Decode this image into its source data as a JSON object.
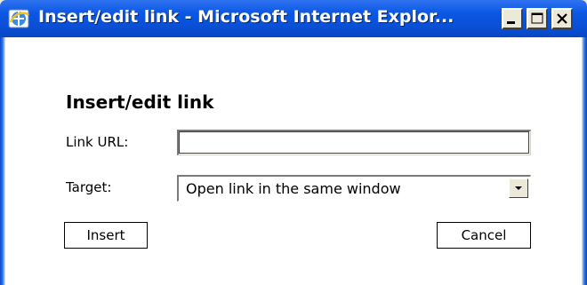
{
  "window": {
    "title": "Insert/edit link - Microsoft Internet Explor...",
    "icon": "ie-icon",
    "controls": [
      "minimize-icon",
      "maximize-icon",
      "close-icon"
    ]
  },
  "dialog": {
    "heading": "Insert/edit link",
    "url_label": "Link URL:",
    "url_value": "",
    "target_label": "Target:",
    "target_selected": "Open link in the same window",
    "insert_label": "Insert",
    "cancel_label": "Cancel"
  },
  "colors": {
    "titlebar": "#0a4fd6",
    "face": "#ece9d8",
    "close_accent": "#000000"
  }
}
